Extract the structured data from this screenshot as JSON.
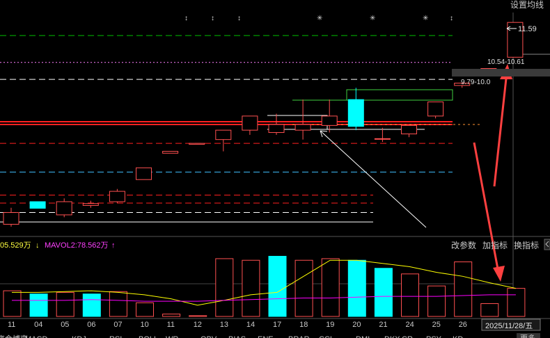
{
  "toolbar": {
    "ma_settings": "设置均线",
    "change_params": "改参数",
    "add_indicator": "加指标",
    "switch_indicator": "换指标",
    "collapse_icon": "chevron-left-icon"
  },
  "price_labels": {
    "high": "11.59",
    "range_upper": "10.54-10.61",
    "range_lower": "9.79-10.0"
  },
  "volume_legend": {
    "vol_label": "05.529万",
    "vol_arrow": "↓",
    "ma2_label": "MAVOL2:78.562万",
    "ma2_arrow": "↑"
  },
  "current_date": "2025/11/28/五",
  "indicator_tabs": [
    "资金博弈",
    "MACD",
    "KDJ",
    "RSI",
    "BOLL",
    "WR",
    "OBV",
    "BIAS",
    "ENE",
    "BRAR",
    "CCI",
    "DMI",
    "DKX",
    "CR",
    "PSY",
    "KD"
  ],
  "more_label": "更多",
  "colors": {
    "up": "#ff5050",
    "down": "#00ffff",
    "ma_yellow": "#ffff00",
    "ma_magenta": "#ff00ff",
    "annotation_arrow": "#ff4040",
    "grid": "#444444"
  },
  "chart_data": {
    "type": "candlestick",
    "x_ticks": [
      "11",
      "04",
      "05",
      "06",
      "07",
      "10",
      "11",
      "12",
      "13",
      "14",
      "17",
      "18",
      "19",
      "20",
      "21",
      "24",
      "25",
      "26"
    ],
    "candles": [
      {
        "date": "11",
        "open": 7.3,
        "close": 7.55,
        "high": 7.65,
        "low": 7.25
      },
      {
        "date": "04",
        "open": 7.78,
        "close": 7.64,
        "high": 7.78,
        "low": 7.64
      },
      {
        "date": "05",
        "open": 7.5,
        "close": 7.78,
        "high": 7.85,
        "low": 7.45
      },
      {
        "date": "06",
        "open": 7.7,
        "close": 7.74,
        "high": 7.8,
        "low": 7.65
      },
      {
        "date": "07",
        "open": 7.78,
        "close": 8.0,
        "high": 8.05,
        "low": 7.75
      },
      {
        "date": "10",
        "open": 8.25,
        "close": 8.5,
        "high": 8.5,
        "low": 8.25
      },
      {
        "date": "11",
        "open": 8.81,
        "close": 8.85,
        "high": 8.85,
        "low": 8.81
      },
      {
        "date": "12",
        "open": 9.0,
        "close": 9.02,
        "high": 9.02,
        "low": 9.0
      },
      {
        "date": "13",
        "open": 9.1,
        "close": 9.3,
        "high": 9.3,
        "low": 8.85
      },
      {
        "date": "14",
        "open": 9.3,
        "close": 9.6,
        "high": 9.6,
        "low": 9.2
      },
      {
        "date": "17",
        "open": 9.25,
        "close": 9.42,
        "high": 9.65,
        "low": 9.2
      },
      {
        "date": "18",
        "open": 9.3,
        "close": 9.42,
        "high": 9.95,
        "low": 9.1
      },
      {
        "date": "19",
        "open": 9.4,
        "close": 9.6,
        "high": 9.95,
        "low": 9.25
      },
      {
        "date": "20",
        "open": 9.95,
        "close": 9.38,
        "high": 10.2,
        "low": 9.3
      },
      {
        "date": "21",
        "open": 9.12,
        "close": 9.12,
        "high": 9.35,
        "low": 9.05
      },
      {
        "date": "24",
        "open": 9.22,
        "close": 9.4,
        "high": 9.4,
        "low": 9.15
      },
      {
        "date": "25",
        "open": 9.6,
        "close": 9.9,
        "high": 9.9,
        "low": 9.55
      },
      {
        "date": "26",
        "open": 10.25,
        "close": 10.3,
        "high": 10.3,
        "low": 10.2
      },
      {
        "date": "27",
        "open": 10.54,
        "close": 10.61,
        "high": 10.61,
        "low": 10.5
      },
      {
        "date": "28",
        "open": 10.85,
        "close": 11.59,
        "high": 11.59,
        "low": 10.85
      }
    ],
    "volume": [
      {
        "date": "11",
        "value": 32,
        "dir": "up"
      },
      {
        "date": "04",
        "value": 28,
        "dir": "down"
      },
      {
        "date": "05",
        "value": 30,
        "dir": "up"
      },
      {
        "date": "06",
        "value": 28,
        "dir": "down"
      },
      {
        "date": "07",
        "value": 31,
        "dir": "up"
      },
      {
        "date": "10",
        "value": 17,
        "dir": "up"
      },
      {
        "date": "11",
        "value": 3,
        "dir": "up"
      },
      {
        "date": "12",
        "value": 1,
        "dir": "up"
      },
      {
        "date": "13",
        "value": 72,
        "dir": "up"
      },
      {
        "date": "14",
        "value": 70,
        "dir": "up"
      },
      {
        "date": "17",
        "value": 75,
        "dir": "down"
      },
      {
        "date": "18",
        "value": 70,
        "dir": "up"
      },
      {
        "date": "19",
        "value": 72,
        "dir": "up"
      },
      {
        "date": "20",
        "value": 70,
        "dir": "down"
      },
      {
        "date": "21",
        "value": 60,
        "dir": "down"
      },
      {
        "date": "24",
        "value": 53,
        "dir": "up"
      },
      {
        "date": "25",
        "value": 38,
        "dir": "up"
      },
      {
        "date": "26",
        "value": 68,
        "dir": "up"
      },
      {
        "date": "27",
        "value": 16,
        "dir": "up"
      },
      {
        "date": "28",
        "value": 35,
        "dir": "up"
      }
    ],
    "ma_vol1": [
      30,
      30,
      31,
      32,
      30,
      27,
      22,
      14,
      20,
      27,
      30,
      50,
      70,
      70,
      66,
      62,
      55,
      50,
      42,
      35
    ],
    "ma_vol2": [
      20,
      20,
      20,
      21,
      20,
      19,
      19,
      19,
      20,
      21,
      22,
      23,
      23,
      24,
      25,
      25,
      25,
      26,
      27,
      27
    ],
    "horizontal_levels": [
      {
        "price": 11.31,
        "color": "#00c000",
        "style": "dash"
      },
      {
        "price": 10.74,
        "color": "#ff80ff",
        "style": "dot"
      },
      {
        "price": 10.38,
        "color": "#ffffff",
        "style": "dash"
      },
      {
        "price": 9.48,
        "color": "#ff2020",
        "style": "solid"
      },
      {
        "price": 9.42,
        "color": "#ff2020",
        "style": "solid"
      },
      {
        "price": 9.02,
        "color": "#ff2020",
        "style": "dash"
      },
      {
        "price": 8.41,
        "color": "#40c0ff",
        "style": "dash"
      },
      {
        "price": 7.92,
        "color": "#ff2020",
        "style": "dash"
      },
      {
        "price": 7.75,
        "color": "#ff2020",
        "style": "dash"
      },
      {
        "price": 7.55,
        "color": "#ffffff",
        "style": "dash"
      },
      {
        "price": 7.35,
        "color": "#ffffff",
        "style": "solid"
      }
    ],
    "ylim": [
      7.1,
      11.8
    ],
    "vol_ylim": [
      0,
      78
    ]
  }
}
